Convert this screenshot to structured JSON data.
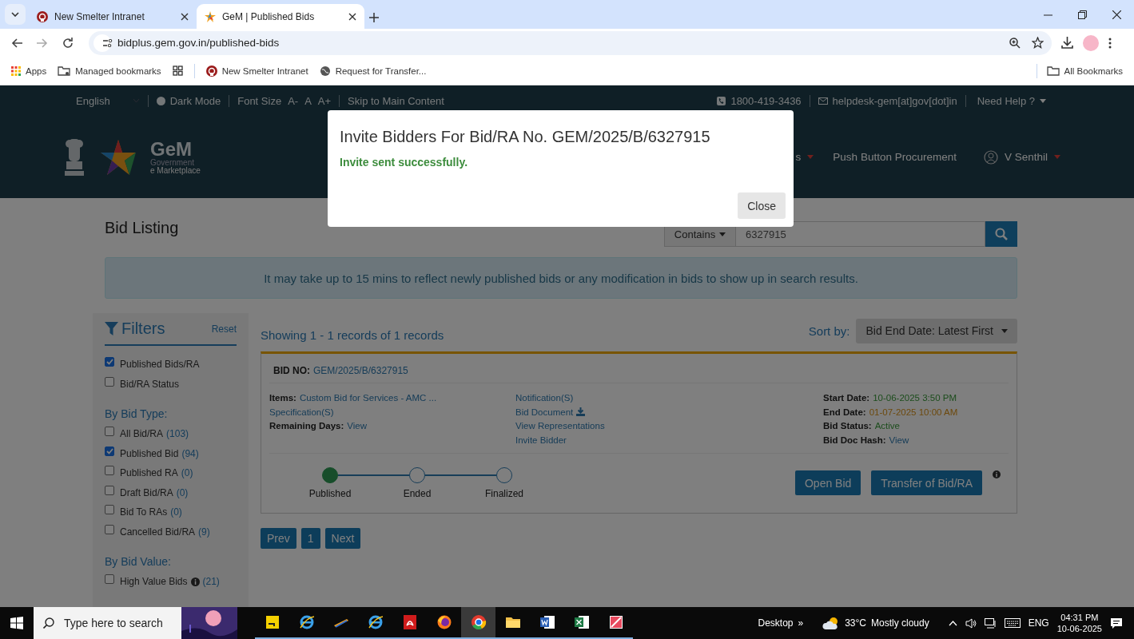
{
  "browser": {
    "tabs": [
      {
        "title": "New Smelter Intranet",
        "selected": false,
        "kind": "intranet"
      },
      {
        "title": "GeM | Published Bids",
        "selected": true,
        "kind": "star"
      }
    ],
    "url": "bidplus.gem.gov.in/published-bids",
    "bookmarks": [
      {
        "label": "Apps",
        "kind": "apps"
      },
      {
        "label": "Managed bookmarks",
        "kind": "folder"
      },
      {
        "kind": "grid"
      },
      {
        "label": "New Smelter Intranet",
        "kind": "intranet"
      },
      {
        "label": "Request for Transfer...",
        "kind": "globe"
      }
    ],
    "all_bookmarks": "All Bookmarks"
  },
  "top_bar": {
    "language": "English",
    "dark_mode": "Dark Mode",
    "font_size": "Font Size",
    "font_sizes": [
      "A-",
      "A",
      "A+"
    ],
    "skip": "Skip to Main Content",
    "phone": "1800-419-3436",
    "email": "helpdesk-gem[at]gov[dot]in",
    "help": "Need Help ?"
  },
  "header": {
    "logo": {
      "name": "GeM",
      "line1": "Government",
      "line2": "e Marketplace"
    },
    "nav": [
      {
        "label": "s",
        "caret": true
      },
      {
        "label": "Push Button Procurement",
        "caret": false
      }
    ],
    "user": "V Senthil"
  },
  "page_title": "Bid Listing",
  "search": {
    "scope": "Contains",
    "value": "6327915"
  },
  "notice": "It may take up to 15 mins to reflect newly published bids or any modification in bids to show up in search results.",
  "filters": {
    "title": "Filters",
    "reset": "Reset",
    "groups": [
      {
        "options": [
          {
            "label": "Published Bids/RA",
            "checked": true
          },
          {
            "label": "Bid/RA Status",
            "checked": false
          }
        ]
      },
      {
        "heading": "By Bid Type:",
        "options": [
          {
            "label": "All Bid/RA",
            "count": "(103)",
            "checked": false
          },
          {
            "label": "Published Bid",
            "count": "(94)",
            "checked": true
          },
          {
            "label": "Published RA",
            "count": "(0)",
            "checked": false
          },
          {
            "label": "Draft Bid/RA",
            "count": "(0)",
            "checked": false
          },
          {
            "label": "Bid To RAs",
            "count": "(0)",
            "checked": false
          },
          {
            "label": "Cancelled Bid/RA",
            "count": "(9)",
            "checked": false
          }
        ]
      },
      {
        "heading": "By Bid Value:",
        "options": [
          {
            "label": "High Value Bids",
            "info": true,
            "count": "(21)",
            "checked": false
          }
        ]
      }
    ]
  },
  "results": {
    "summary": "Showing 1 - 1 records of 1 records",
    "sort_label": "Sort by:",
    "sort_value": "Bid End Date: Latest First",
    "bid": {
      "no_label": "BID NO:",
      "no": "GEM/2025/B/6327915",
      "left": [
        {
          "label": "Items:",
          "value": "Custom Bid for Services - AMC ..."
        },
        {
          "value": "Specification(S)"
        },
        {
          "label": "Remaining Days:",
          "value": "View"
        }
      ],
      "middle": [
        {
          "label": "Notification(S)",
          "download": false
        },
        {
          "label": "Bid Document",
          "download": true
        },
        {
          "label": "View Representations",
          "download": false
        },
        {
          "label": "Invite Bidder",
          "download": false
        }
      ],
      "right": [
        {
          "label": "Start Date:",
          "value": "10-06-2025 3:50 PM",
          "kind": "start"
        },
        {
          "label": "End Date:",
          "value": "01-07-2025 10:00 AM",
          "kind": "deadline"
        },
        {
          "label": "Bid Status:",
          "value": "Active",
          "kind": "status"
        },
        {
          "label": "Bid Doc Hash:",
          "value": "View",
          "kind": "link"
        }
      ],
      "steps": [
        {
          "label": "Published",
          "done": true
        },
        {
          "label": "Ended",
          "done": false
        },
        {
          "label": "Finalized",
          "done": false
        }
      ],
      "buttons": [
        "Open Bid",
        "Transfer of Bid/RA"
      ]
    },
    "pages": [
      {
        "label": "Prev"
      },
      {
        "label": "1"
      },
      {
        "label": "Next"
      }
    ]
  },
  "modal": {
    "title": "Invite Bidders For Bid/RA No. GEM/2025/B/6327915",
    "message": "Invite sent successfully.",
    "close": "Close"
  },
  "taskbar": {
    "search_placeholder": "Type here to search",
    "apps": [
      {
        "kind": "notes",
        "selected": false
      },
      {
        "kind": "ebrowser",
        "selected": false
      },
      {
        "kind": "pencil",
        "selected": false
      },
      {
        "kind": "ebrowser",
        "selected": false
      },
      {
        "kind": "pdf",
        "selected": false
      },
      {
        "kind": "fox",
        "selected": false
      },
      {
        "kind": "round",
        "selected": true
      },
      {
        "kind": "folder",
        "selected": false
      },
      {
        "kind": "doc",
        "selected": false
      },
      {
        "kind": "sheet",
        "selected": false
      },
      {
        "kind": "paint",
        "selected": false
      }
    ],
    "desktop": "Desktop",
    "chevron": "»",
    "temperature": "33°C",
    "weather": "Mostly cloudy",
    "language": "ENG",
    "time": "04:31 PM",
    "date": "10-06-2025"
  }
}
